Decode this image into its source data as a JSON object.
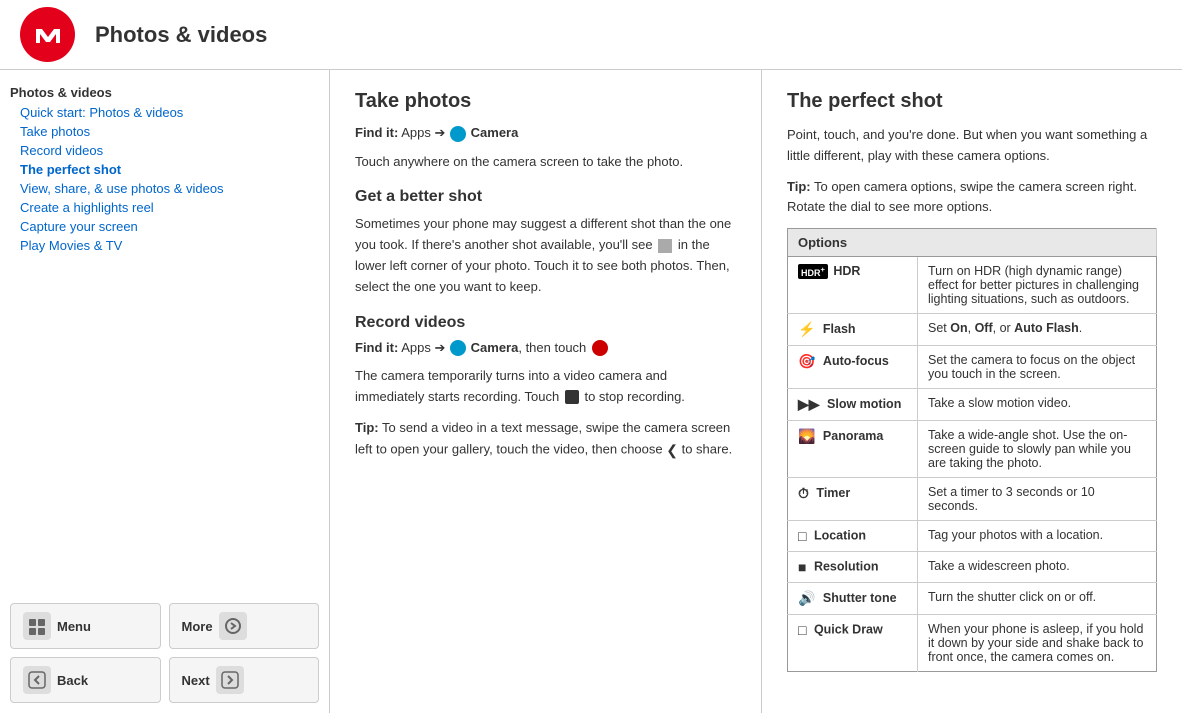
{
  "header": {
    "title": "Photos & videos"
  },
  "sidebar": {
    "section": "Photos & videos",
    "items": [
      {
        "label": "Quick start: Photos & videos",
        "indent": true
      },
      {
        "label": "Take photos",
        "indent": false
      },
      {
        "label": "Record videos",
        "indent": true
      },
      {
        "label": "The perfect shot",
        "indent": true
      },
      {
        "label": "View, share, & use photos & videos",
        "indent": false
      },
      {
        "label": "Create a highlights reel",
        "indent": true
      },
      {
        "label": "Capture your screen",
        "indent": false
      },
      {
        "label": "Play Movies & TV",
        "indent": true
      }
    ]
  },
  "bottom_nav": {
    "menu_label": "Menu",
    "more_label": "More",
    "back_label": "Back",
    "next_label": "Next"
  },
  "left_content": {
    "take_photos": {
      "title": "Take photos",
      "find_it_prefix": "Find it:",
      "find_it_text": " Apps  ➔  Camera",
      "body": "Touch anywhere on the camera screen to take the photo."
    },
    "better_shot": {
      "title": "Get a better shot",
      "body": "Sometimes your phone may suggest a different shot than the one you took. If there's another shot available, you'll see  in the lower left corner of your photo. Touch it to see both photos. Then, select the one you want to keep."
    },
    "record_videos": {
      "title": "Record videos",
      "find_it_prefix": "Find it:",
      "find_it_text": " Apps  ➔  Camera, then touch",
      "body1": "The camera temporarily turns into a video camera and immediately starts recording. Touch  to stop recording.",
      "tip": "Tip:",
      "tip_text": " To send a video in a text message, swipe the camera screen left to open your gallery, touch the video, then choose  to share."
    }
  },
  "right_content": {
    "title": "The perfect shot",
    "intro": "Point, touch, and you're done. But when you want something a little different, play with these camera options.",
    "tip_label": "Tip:",
    "tip_text": " To open camera options, swipe the camera screen right. Rotate the dial to see more options.",
    "table_header": "Options",
    "options": [
      {
        "icon_type": "hdr",
        "name": "HDR",
        "description": "Turn on HDR (high dynamic range) effect for better pictures in challenging lighting situations, such as outdoors."
      },
      {
        "icon_type": "flash",
        "name": "Flash",
        "description": "Set On, Off, or Auto Flash."
      },
      {
        "icon_type": "autofocus",
        "name": "Auto-focus",
        "description": "Set the camera to focus on the object you touch in the screen."
      },
      {
        "icon_type": "slowmotion",
        "name": "Slow motion",
        "description": "Take a slow motion video."
      },
      {
        "icon_type": "panorama",
        "name": "Panorama",
        "description": "Take a wide-angle shot. Use the on-screen guide to slowly pan while you are taking the photo."
      },
      {
        "icon_type": "timer",
        "name": "Timer",
        "description": "Set a timer to 3 seconds or 10 seconds."
      },
      {
        "icon_type": "location",
        "name": "Location",
        "description": "Tag your photos with a location."
      },
      {
        "icon_type": "resolution",
        "name": "Resolution",
        "description": "Take a widescreen photo."
      },
      {
        "icon_type": "shuttertone",
        "name": "Shutter tone",
        "description": "Turn the shutter click on or off."
      },
      {
        "icon_type": "quickdraw",
        "name": "Quick Draw",
        "description": "When your phone is asleep, if you hold it down by your side and shake back to front once, the camera comes on."
      }
    ]
  }
}
